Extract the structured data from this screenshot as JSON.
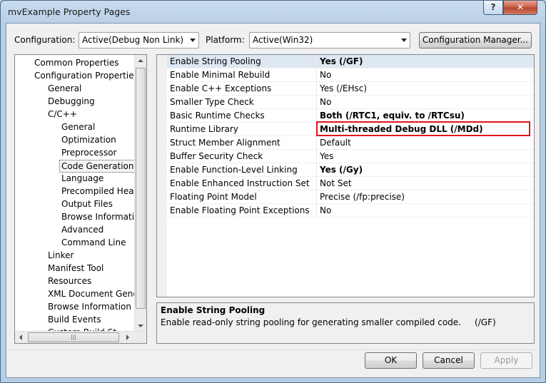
{
  "window": {
    "title": "mvExample Property Pages",
    "help_label": "?",
    "close_label": "✕"
  },
  "toolbar": {
    "configuration_label": "Configuration:",
    "configuration_value": "Active(Debug Non Link)",
    "platform_label": "Platform:",
    "platform_value": "Active(Win32)",
    "config_manager_label": "Configuration Manager..."
  },
  "tree": {
    "items": [
      {
        "label": "Common Properties",
        "level": 0
      },
      {
        "label": "Configuration Properties",
        "level": 0
      },
      {
        "label": "General",
        "level": 1
      },
      {
        "label": "Debugging",
        "level": 1
      },
      {
        "label": "C/C++",
        "level": 1
      },
      {
        "label": "General",
        "level": 2
      },
      {
        "label": "Optimization",
        "level": 2
      },
      {
        "label": "Preprocessor",
        "level": 2
      },
      {
        "label": "Code Generation",
        "level": 2,
        "selected": true
      },
      {
        "label": "Language",
        "level": 2
      },
      {
        "label": "Precompiled Heade",
        "level": 2
      },
      {
        "label": "Output Files",
        "level": 2
      },
      {
        "label": "Browse Information",
        "level": 2
      },
      {
        "label": "Advanced",
        "level": 2
      },
      {
        "label": "Command Line",
        "level": 2
      },
      {
        "label": "Linker",
        "level": 1
      },
      {
        "label": "Manifest Tool",
        "level": 1
      },
      {
        "label": "Resources",
        "level": 1
      },
      {
        "label": "XML Document Genera",
        "level": 1
      },
      {
        "label": "Browse Information",
        "level": 1
      },
      {
        "label": "Build Events",
        "level": 1
      },
      {
        "label": "Custom Build St",
        "level": 1
      }
    ],
    "hscroll_grip": "|||"
  },
  "properties": {
    "rows": [
      {
        "name": "Enable String Pooling",
        "value": "Yes (/GF)",
        "bold": true,
        "highlight": true
      },
      {
        "name": "Enable Minimal Rebuild",
        "value": "No",
        "bold": false
      },
      {
        "name": "Enable C++ Exceptions",
        "value": "Yes (/EHsc)",
        "bold": false
      },
      {
        "name": "Smaller Type Check",
        "value": "No",
        "bold": false
      },
      {
        "name": "Basic Runtime Checks",
        "value": "Both (/RTC1, equiv. to /RTCsu)",
        "bold": true
      },
      {
        "name": "Runtime Library",
        "value": "Multi-threaded Debug DLL (/MDd)",
        "bold": true
      },
      {
        "name": "Struct Member Alignment",
        "value": "Default",
        "bold": false
      },
      {
        "name": "Buffer Security Check",
        "value": "Yes",
        "bold": false
      },
      {
        "name": "Enable Function-Level Linking",
        "value": "Yes (/Gy)",
        "bold": true
      },
      {
        "name": "Enable Enhanced Instruction Set",
        "value": "Not Set",
        "bold": false
      },
      {
        "name": "Floating Point Model",
        "value": "Precise (/fp:precise)",
        "bold": false
      },
      {
        "name": "Enable Floating Point Exceptions",
        "value": "No",
        "bold": false
      }
    ]
  },
  "description": {
    "title": "Enable String Pooling",
    "text": "Enable read-only string pooling for generating smaller compiled code.     (/GF)"
  },
  "buttons": {
    "ok": "OK",
    "cancel": "Cancel",
    "apply": "Apply"
  },
  "colors": {
    "highlight_box": "#e0141e",
    "window_frame": "#b7cfe6"
  }
}
